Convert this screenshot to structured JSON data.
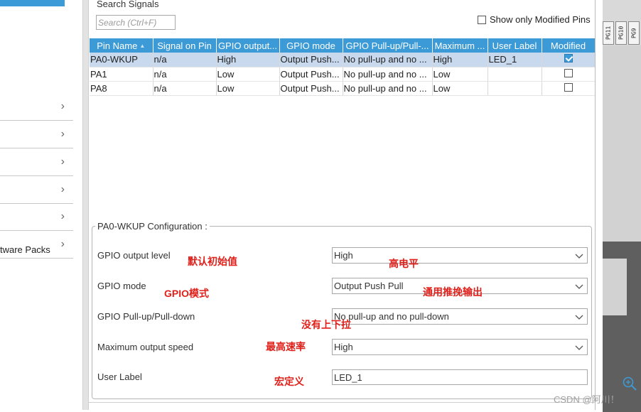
{
  "sidebar": {
    "items": [
      {
        "label": ""
      },
      {
        "label": ""
      },
      {
        "label": ""
      },
      {
        "label": ""
      },
      {
        "label": ""
      },
      {
        "label": "tware Packs"
      }
    ]
  },
  "search": {
    "title": "Search Signals",
    "placeholder": "Search (Ctrl+F)"
  },
  "show_modified": {
    "label": "Show only Modified Pins",
    "checked": false
  },
  "table": {
    "columns": [
      "Pin Name",
      "Signal on Pin",
      "GPIO output...",
      "GPIO mode",
      "GPIO Pull-up/Pull-...",
      "Maximum ...",
      "User Label",
      "Modified"
    ],
    "rows": [
      {
        "pin": "PA0-WKUP",
        "signal": "n/a",
        "output": "High",
        "mode": "Output Push...",
        "pull": "No pull-up and no ...",
        "speed": "High",
        "label": "LED_1",
        "modified": true
      },
      {
        "pin": "PA1",
        "signal": "n/a",
        "output": "Low",
        "mode": "Output Push...",
        "pull": "No pull-up and no ...",
        "speed": "Low",
        "label": "",
        "modified": false
      },
      {
        "pin": "PA8",
        "signal": "n/a",
        "output": "Low",
        "mode": "Output Push...",
        "pull": "No pull-up and no ...",
        "speed": "Low",
        "label": "",
        "modified": false
      }
    ]
  },
  "config": {
    "title": "PA0-WKUP Configuration :",
    "fields": [
      {
        "label": "GPIO output level",
        "value": "High",
        "note_left": "默认初始值",
        "note_right": "高电平"
      },
      {
        "label": "GPIO mode",
        "value": "Output Push Pull",
        "note_left": "GPIO模式",
        "note_right": "通用推挽输出"
      },
      {
        "label": "GPIO Pull-up/Pull-down",
        "value": "No pull-up and no pull-down",
        "note_left": "",
        "note_right": "没有上下拉"
      },
      {
        "label": "Maximum output speed",
        "value": "High",
        "note_left": "最高速率",
        "note_right": ""
      },
      {
        "label": "User Label",
        "value": "LED_1",
        "note_left": "宏定义",
        "note_right": ""
      }
    ]
  },
  "chip": {
    "pins": [
      "PG11",
      "PG10",
      "PG9"
    ]
  },
  "watermark": "CSDN @阿川！",
  "colors": {
    "accent": "#3c9ad6",
    "selected_row": "#c8d9ee",
    "annotation": "#e0201a"
  }
}
